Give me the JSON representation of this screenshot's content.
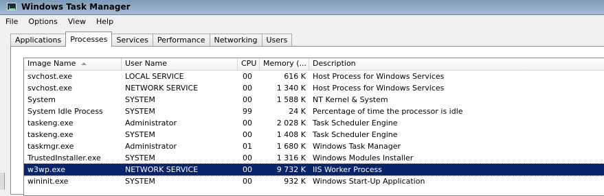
{
  "window": {
    "title": "Windows Task Manager"
  },
  "menu": [
    "File",
    "Options",
    "View",
    "Help"
  ],
  "tabs": [
    {
      "label": "Applications",
      "active": false
    },
    {
      "label": "Processes",
      "active": true
    },
    {
      "label": "Services",
      "active": false
    },
    {
      "label": "Performance",
      "active": false
    },
    {
      "label": "Networking",
      "active": false
    },
    {
      "label": "Users",
      "active": false
    }
  ],
  "columns": {
    "image_name": "Image Name",
    "user_name": "User Name",
    "cpu": "CPU",
    "memory": "Memory (...",
    "description": "Description"
  },
  "sort": {
    "column": "Image Name",
    "direction": "ascending"
  },
  "rows": [
    {
      "name": "svchost.exe",
      "user": "LOCAL SERVICE",
      "cpu": "00",
      "mem": "616 K",
      "desc": "Host Process for Windows Services"
    },
    {
      "name": "svchost.exe",
      "user": "NETWORK SERVICE",
      "cpu": "00",
      "mem": "1 340 K",
      "desc": "Host Process for Windows Services"
    },
    {
      "name": "System",
      "user": "SYSTEM",
      "cpu": "00",
      "mem": "1 588 K",
      "desc": "NT Kernel & System"
    },
    {
      "name": "System Idle Process",
      "user": "SYSTEM",
      "cpu": "99",
      "mem": "24 K",
      "desc": "Percentage of time the processor is idle"
    },
    {
      "name": "taskeng.exe",
      "user": "Administrator",
      "cpu": "00",
      "mem": "2 028 K",
      "desc": "Task Scheduler Engine"
    },
    {
      "name": "taskeng.exe",
      "user": "SYSTEM",
      "cpu": "00",
      "mem": "1 408 K",
      "desc": "Task Scheduler Engine"
    },
    {
      "name": "taskmgr.exe",
      "user": "Administrator",
      "cpu": "01",
      "mem": "1 680 K",
      "desc": "Windows Task Manager"
    },
    {
      "name": "TrustedInstaller.exe",
      "user": "SYSTEM",
      "cpu": "00",
      "mem": "1 316 K",
      "desc": "Windows Modules Installer"
    },
    {
      "name": "w3wp.exe",
      "user": "NETWORK SERVICE",
      "cpu": "00",
      "mem": "9 732 K",
      "desc": "IIS Worker Process",
      "selected": true
    },
    {
      "name": "wininit.exe",
      "user": "SYSTEM",
      "cpu": "00",
      "mem": "932 K",
      "desc": "Windows Start-Up Application"
    }
  ],
  "colors": {
    "selection": "#0a246a",
    "titlebar": "#8fa9c2"
  }
}
